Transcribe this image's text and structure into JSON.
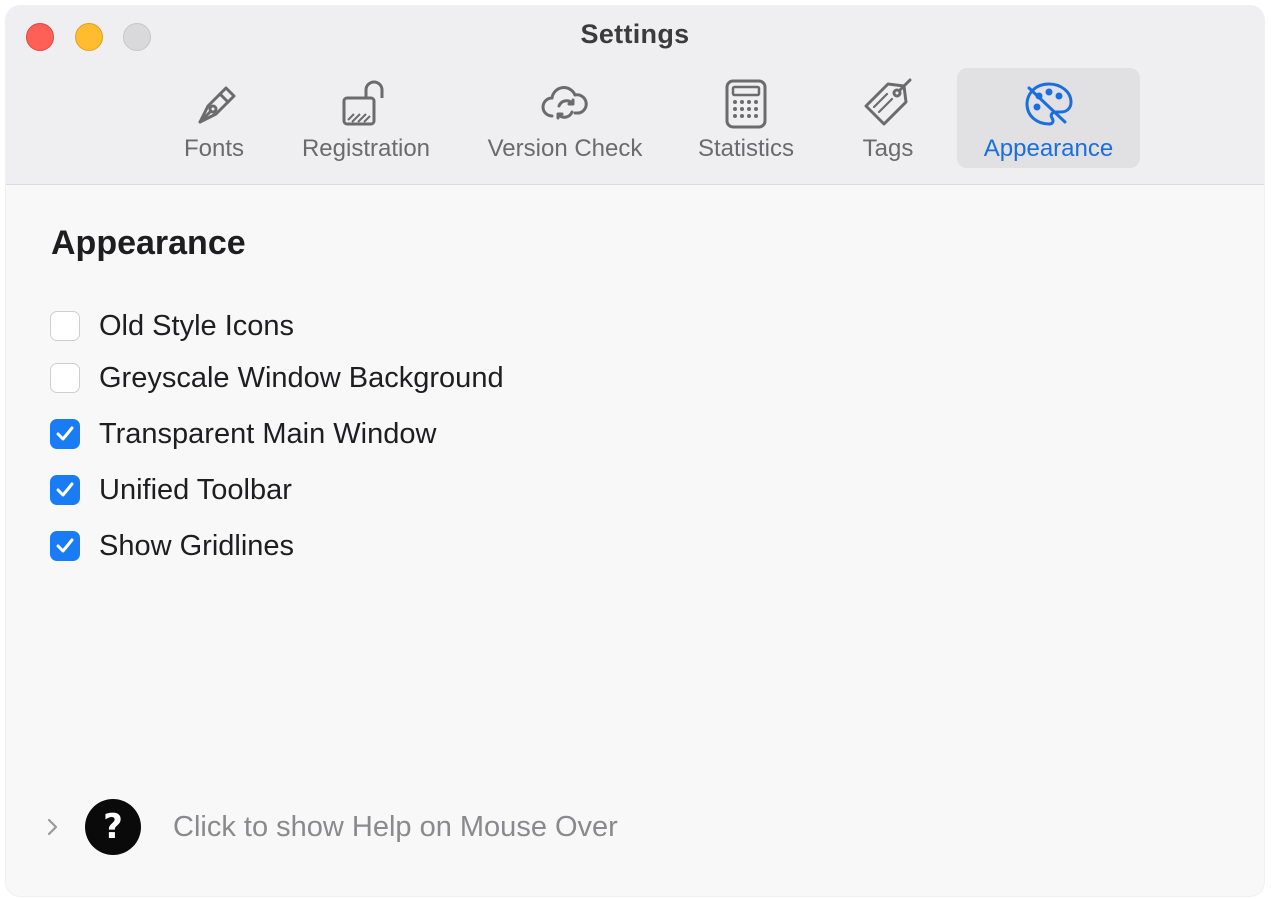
{
  "window": {
    "title": "Settings"
  },
  "toolbar": {
    "items": [
      {
        "label": "Fonts",
        "icon": "fountain-pen-icon",
        "selected": false
      },
      {
        "label": "Registration",
        "icon": "unlocked-padlock-icon",
        "selected": false
      },
      {
        "label": "Version Check",
        "icon": "cloud-sync-icon",
        "selected": false
      },
      {
        "label": "Statistics",
        "icon": "calculator-icon",
        "selected": false
      },
      {
        "label": "Tags",
        "icon": "tag-icon",
        "selected": false
      },
      {
        "label": "Appearance",
        "icon": "palette-icon",
        "selected": true
      }
    ],
    "selected_color": "#1a6fe0"
  },
  "appearance": {
    "heading": "Appearance",
    "options": [
      {
        "label": "Old Style Icons",
        "checked": false
      },
      {
        "label": "Greyscale Window Background",
        "checked": false
      },
      {
        "label": "Transparent Main Window",
        "checked": true
      },
      {
        "label": "Unified Toolbar",
        "checked": true
      },
      {
        "label": "Show Gridlines",
        "checked": true
      }
    ],
    "checkbox_color": "#1a7cf5"
  },
  "help": {
    "label": "Click to show Help on Mouse Over",
    "icon": "question-mark-icon",
    "glyph": "?"
  }
}
